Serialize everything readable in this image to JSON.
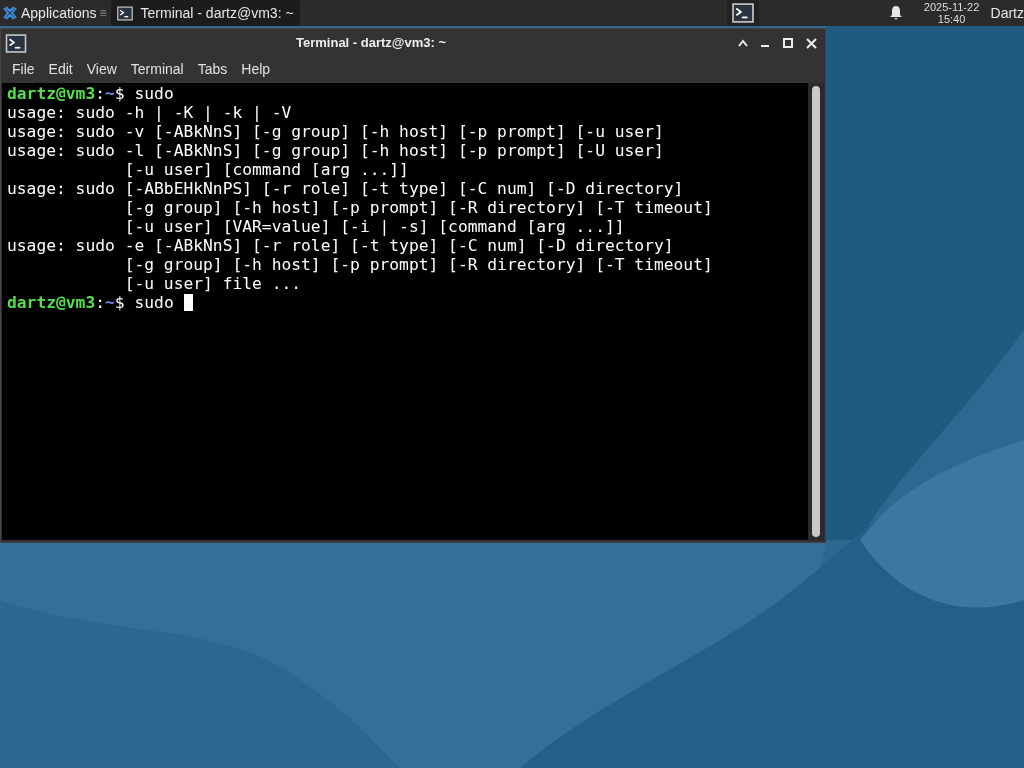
{
  "panel": {
    "apps_label": "Applications",
    "separator": "≡",
    "tasks": [
      {
        "label": "Terminal - dartz@vm3: ~",
        "selected": true
      }
    ],
    "clock_date": "2025-11-22",
    "clock_time": "15:40",
    "user": "Dartz"
  },
  "window": {
    "title": "Terminal - dartz@vm3: ~",
    "menu": [
      "File",
      "Edit",
      "View",
      "Terminal",
      "Tabs",
      "Help"
    ]
  },
  "terminal": {
    "lines": [
      {
        "kind": "prompt",
        "user_host": "dartz@vm3",
        "colon": ":",
        "path": "~",
        "symbol": "$",
        "command": "sudo",
        "cursor": false
      },
      {
        "kind": "output",
        "text": "usage: sudo -h | -K | -k | -V"
      },
      {
        "kind": "output",
        "text": "usage: sudo -v [-ABkNnS] [-g group] [-h host] [-p prompt] [-u user]"
      },
      {
        "kind": "output",
        "text": "usage: sudo -l [-ABkNnS] [-g group] [-h host] [-p prompt] [-U user]"
      },
      {
        "kind": "output",
        "text": "            [-u user] [command [arg ...]]"
      },
      {
        "kind": "output",
        "text": "usage: sudo [-ABbEHkNnPS] [-r role] [-t type] [-C num] [-D directory]"
      },
      {
        "kind": "output",
        "text": "            [-g group] [-h host] [-p prompt] [-R directory] [-T timeout]"
      },
      {
        "kind": "output",
        "text": "            [-u user] [VAR=value] [-i | -s] [command [arg ...]]"
      },
      {
        "kind": "output",
        "text": "usage: sudo -e [-ABkNnS] [-r role] [-t type] [-C num] [-D directory]"
      },
      {
        "kind": "output",
        "text": "            [-g group] [-h host] [-p prompt] [-R directory] [-T timeout]"
      },
      {
        "kind": "output",
        "text": "            [-u user] file ..."
      },
      {
        "kind": "prompt",
        "user_host": "dartz@vm3",
        "colon": ":",
        "path": "~",
        "symbol": "$",
        "command": "sudo ",
        "cursor": true
      }
    ]
  }
}
